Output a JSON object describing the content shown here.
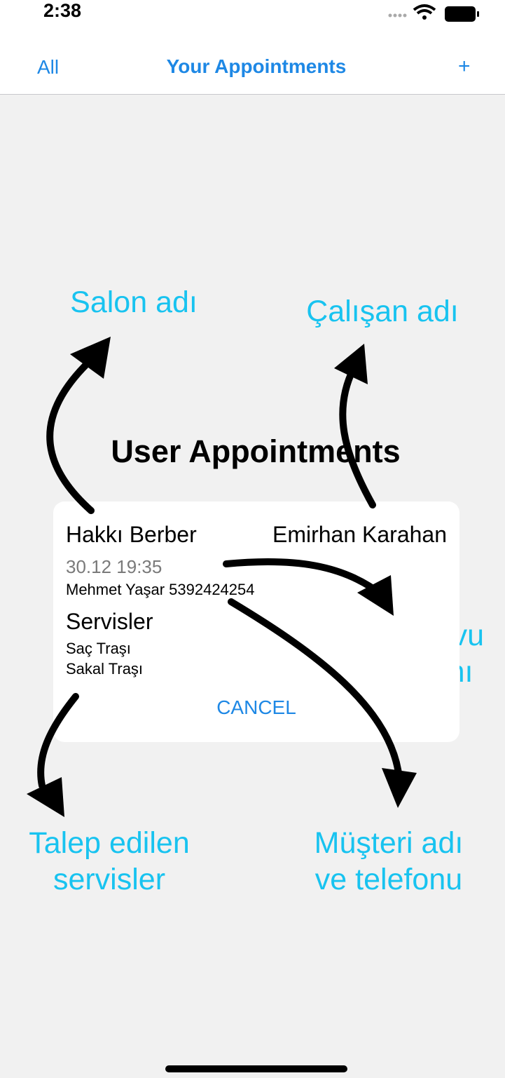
{
  "status_bar": {
    "time": "2:38"
  },
  "nav": {
    "left": "All",
    "title": "Your Appointments",
    "right": "+"
  },
  "section_title": "User Appointments",
  "appointment": {
    "salon": "Hakkı Berber",
    "employee": "Emirhan Karahan",
    "datetime": "30.12 19:35",
    "customer": "Mehmet Yaşar 5392424254",
    "services_title": "Servisler",
    "services": [
      "Saç Traşı",
      "Sakal Traşı"
    ],
    "cancel_label": "CANCEL"
  },
  "annotations": {
    "salon_name": "Salon adı",
    "employee_name": "Çalışan adı",
    "appointment_time_1": "Randevu",
    "appointment_time_2": "zamanı",
    "requested_services_1": "Talep edilen",
    "requested_services_2": "servisler",
    "customer_info_1": "Müşteri adı",
    "customer_info_2": "ve telefonu"
  },
  "colors": {
    "accent": "#1e88e5",
    "annotation": "#18c3f0",
    "background": "#f1f1f1"
  }
}
